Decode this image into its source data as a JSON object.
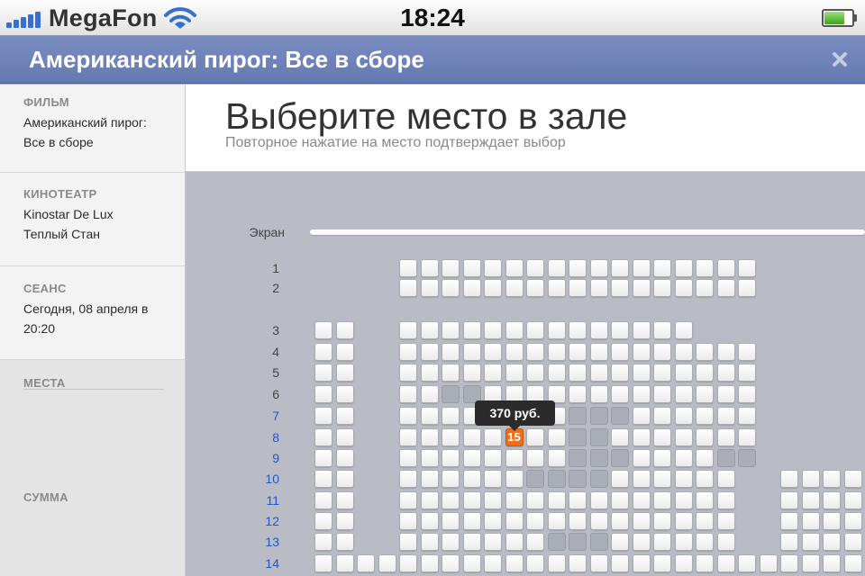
{
  "status_bar": {
    "carrier": "MegaFon",
    "time": "18:24",
    "icons": [
      "signal-bars-icon",
      "wifi-icon",
      "battery-icon"
    ]
  },
  "title_bar": {
    "title": "Американский пирог: Все в сборе",
    "close_icon": "close-icon"
  },
  "sidebar": {
    "film": {
      "heading": "ФИЛЬМ",
      "lines": [
        "Американский пирог:",
        "Все в сборе"
      ]
    },
    "cinema": {
      "heading": "КИНОТЕАТР",
      "lines": [
        "Kinostar De Lux",
        "Теплый Стан"
      ]
    },
    "session": {
      "heading": "СЕАНС",
      "lines": [
        "Сегодня, 08 апреля в",
        "20:20"
      ]
    },
    "seats": {
      "heading": "МЕСТА"
    },
    "total": {
      "heading": "СУММА"
    }
  },
  "main": {
    "title": "Выберите место в зале",
    "subtitle": "Повторное нажатие на место подтверждает выбор"
  },
  "hall": {
    "screen_label": "Экран",
    "rows": [
      {
        "label": "1",
        "active": false
      },
      {
        "label": "2",
        "active": false
      },
      {
        "label": "3",
        "active": false
      },
      {
        "label": "4",
        "active": false
      },
      {
        "label": "5",
        "active": false
      },
      {
        "label": "6",
        "active": false
      },
      {
        "label": "7",
        "active": true
      },
      {
        "label": "8",
        "active": true
      },
      {
        "label": "9",
        "active": true
      },
      {
        "label": "10",
        "active": true
      },
      {
        "label": "11",
        "active": true
      },
      {
        "label": "12",
        "active": true
      },
      {
        "label": "13",
        "active": true
      },
      {
        "label": "14",
        "active": true
      }
    ],
    "selected_seat": {
      "row": "8",
      "number": "15"
    },
    "tooltip_price": "370 руб."
  },
  "colors": {
    "title_bar": "#6d80b8",
    "active_row_label": "#2457c5",
    "inactive_row_label": "#444444",
    "selected_seat": "#ee6f15",
    "taken_seat": "#a9adb5"
  }
}
